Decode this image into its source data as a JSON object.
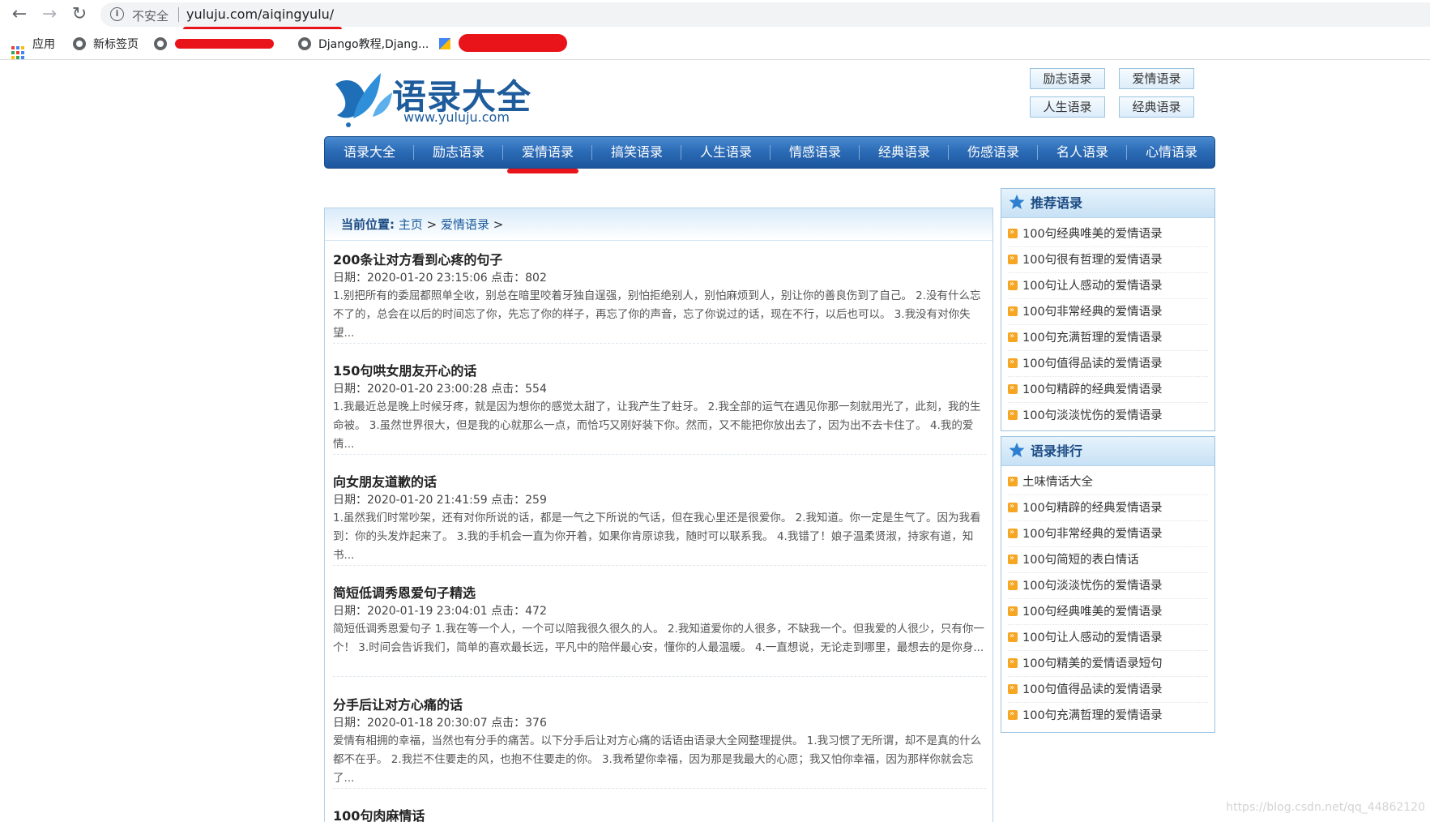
{
  "browser": {
    "insecure_label": "不安全",
    "url": "yuluju.com/aiqingyulu/",
    "bookmarks": [
      {
        "label": "应用",
        "icon": "apps-grid-icon"
      },
      {
        "label": "新标签页",
        "icon": "globe-icon"
      },
      {
        "label": "",
        "icon": "globe-icon"
      },
      {
        "label": "Django教程,Djang...",
        "icon": "globe-icon"
      },
      {
        "label": "",
        "icon": "bookmark-color-icon"
      }
    ]
  },
  "site": {
    "logo_title": "语录大全",
    "logo_url": "www.yuluju.com",
    "top_links": [
      "励志语录",
      "爱情语录",
      "人生语录",
      "经典语录"
    ],
    "nav": [
      "语录大全",
      "励志语录",
      "爱情语录",
      "搞笑语录",
      "人生语录",
      "情感语录",
      "经典语录",
      "伤感语录",
      "名人语录",
      "心情语录"
    ],
    "nav_active_index": 2,
    "accent_color": "#2c6cb7",
    "bullet_color": "#f5a623"
  },
  "breadcrumb": {
    "label": "当前位置:",
    "home": "主页",
    "sep": ">",
    "current": "爱情语录"
  },
  "articles": [
    {
      "title": "200条让对方看到心疼的句子",
      "meta": "日期：2020-01-20 23:15:06 点击：802",
      "excerpt": "1.别把所有的委屈都照单全收，别总在暗里咬着牙独自逞强，别怕拒绝别人，别怕麻烦到人，别让你的善良伤到了自己。 2.没有什么忘不了的，总会在以后的时间忘了你，先忘了你的样子，再忘了你的声音，忘了你说过的话，现在不行，以后也可以。 3.我没有对你失望..."
    },
    {
      "title": "150句哄女朋友开心的话",
      "meta": "日期：2020-01-20 23:00:28 点击：554",
      "excerpt": "1.我最近总是晚上时候牙疼，就是因为想你的感觉太甜了，让我产生了蛀牙。 2.我全部的运气在遇见你那一刻就用光了，此刻，我的生命被。 3.虽然世界很大，但是我的心就那么一点，而恰巧又刚好装下你。然而，又不能把你放出去了，因为出不去卡住了。 4.我的爱情..."
    },
    {
      "title": "向女朋友道歉的话",
      "meta": "日期：2020-01-20 21:41:59 点击：259",
      "excerpt": "1.虽然我们时常吵架，还有对你所说的话，都是一气之下所说的气话，但在我心里还是很爱你。 2.我知道。你一定是生气了。因为我看到：你的头发炸起来了。 3.我的手机会一直为你开着，如果你肯原谅我，随时可以联系我。 4.我错了！娘子温柔贤淑，持家有道，知书..."
    },
    {
      "title": "简短低调秀恩爱句子精选",
      "meta": "日期：2020-01-19 23:04:01 点击：472",
      "excerpt": "简短低调秀恩爱句子 1.我在等一个人，一个可以陪我很久很久的人。 2.我知道爱你的人很多，不缺我一个。但我爱的人很少，只有你一个！ 3.时间会告诉我们，简单的喜欢最长远，平凡中的陪伴最心安，懂你的人最温暖。 4.一直想说，无论走到哪里，最想去的是你身..."
    },
    {
      "title": "分手后让对方心痛的话",
      "meta": "日期：2020-01-18 20:30:07 点击：376",
      "excerpt": "爱情有相拥的幸福，当然也有分手的痛苦。以下分手后让对方心痛的话语由语录大全网整理提供。 1.我习惯了无所谓，却不是真的什么都不在乎。 2.我拦不住要走的风，也抱不住要走的你。 3.我希望你幸福，因为那是我最大的心愿；我又怕你幸福，因为那样你就会忘了..."
    },
    {
      "title": "100句肉麻情话",
      "meta": "",
      "excerpt": ""
    }
  ],
  "sidebar": {
    "recommended": {
      "title": "推荐语录",
      "items": [
        "100句经典唯美的爱情语录",
        "100句很有哲理的爱情语录",
        "100句让人感动的爱情语录",
        "100句非常经典的爱情语录",
        "100句充满哲理的爱情语录",
        "100句值得品读的爱情语录",
        "100句精辟的经典爱情语录",
        "100句淡淡忧伤的爱情语录"
      ]
    },
    "ranking": {
      "title": "语录排行",
      "items": [
        "土味情话大全",
        "100句精辟的经典爱情语录",
        "100句非常经典的爱情语录",
        "100句简短的表白情话",
        "100句淡淡忧伤的爱情语录",
        "100句经典唯美的爱情语录",
        "100句让人感动的爱情语录",
        "100句精美的爱情语录短句",
        "100句值得品读的爱情语录",
        "100句充满哲理的爱情语录"
      ]
    }
  },
  "watermark": "https://blog.csdn.net/qq_44862120"
}
